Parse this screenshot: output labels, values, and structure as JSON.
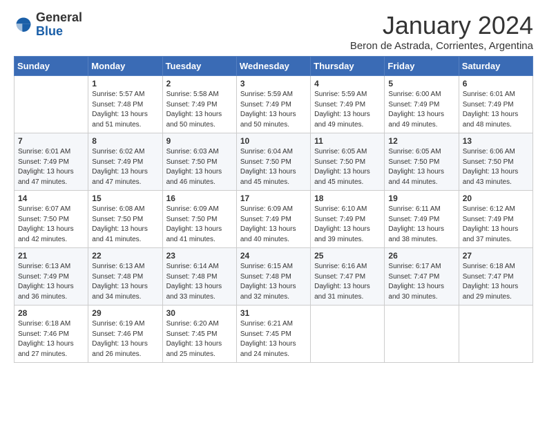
{
  "logo": {
    "general": "General",
    "blue": "Blue"
  },
  "title": "January 2024",
  "subtitle": "Beron de Astrada, Corrientes, Argentina",
  "headers": [
    "Sunday",
    "Monday",
    "Tuesday",
    "Wednesday",
    "Thursday",
    "Friday",
    "Saturday"
  ],
  "weeks": [
    [
      {
        "day": "",
        "info": ""
      },
      {
        "day": "1",
        "info": "Sunrise: 5:57 AM\nSunset: 7:48 PM\nDaylight: 13 hours\nand 51 minutes."
      },
      {
        "day": "2",
        "info": "Sunrise: 5:58 AM\nSunset: 7:49 PM\nDaylight: 13 hours\nand 50 minutes."
      },
      {
        "day": "3",
        "info": "Sunrise: 5:59 AM\nSunset: 7:49 PM\nDaylight: 13 hours\nand 50 minutes."
      },
      {
        "day": "4",
        "info": "Sunrise: 5:59 AM\nSunset: 7:49 PM\nDaylight: 13 hours\nand 49 minutes."
      },
      {
        "day": "5",
        "info": "Sunrise: 6:00 AM\nSunset: 7:49 PM\nDaylight: 13 hours\nand 49 minutes."
      },
      {
        "day": "6",
        "info": "Sunrise: 6:01 AM\nSunset: 7:49 PM\nDaylight: 13 hours\nand 48 minutes."
      }
    ],
    [
      {
        "day": "7",
        "info": ""
      },
      {
        "day": "8",
        "info": "Sunrise: 6:02 AM\nSunset: 7:49 PM\nDaylight: 13 hours\nand 47 minutes."
      },
      {
        "day": "9",
        "info": "Sunrise: 6:03 AM\nSunset: 7:50 PM\nDaylight: 13 hours\nand 46 minutes."
      },
      {
        "day": "10",
        "info": "Sunrise: 6:04 AM\nSunset: 7:50 PM\nDaylight: 13 hours\nand 45 minutes."
      },
      {
        "day": "11",
        "info": "Sunrise: 6:05 AM\nSunset: 7:50 PM\nDaylight: 13 hours\nand 45 minutes."
      },
      {
        "day": "12",
        "info": "Sunrise: 6:05 AM\nSunset: 7:50 PM\nDaylight: 13 hours\nand 44 minutes."
      },
      {
        "day": "13",
        "info": "Sunrise: 6:06 AM\nSunset: 7:50 PM\nDaylight: 13 hours\nand 43 minutes."
      }
    ],
    [
      {
        "day": "14",
        "info": ""
      },
      {
        "day": "15",
        "info": "Sunrise: 6:08 AM\nSunset: 7:50 PM\nDaylight: 13 hours\nand 41 minutes."
      },
      {
        "day": "16",
        "info": "Sunrise: 6:09 AM\nSunset: 7:50 PM\nDaylight: 13 hours\nand 41 minutes."
      },
      {
        "day": "17",
        "info": "Sunrise: 6:09 AM\nSunset: 7:49 PM\nDaylight: 13 hours\nand 40 minutes."
      },
      {
        "day": "18",
        "info": "Sunrise: 6:10 AM\nSunset: 7:49 PM\nDaylight: 13 hours\nand 39 minutes."
      },
      {
        "day": "19",
        "info": "Sunrise: 6:11 AM\nSunset: 7:49 PM\nDaylight: 13 hours\nand 38 minutes."
      },
      {
        "day": "20",
        "info": "Sunrise: 6:12 AM\nSunset: 7:49 PM\nDaylight: 13 hours\nand 37 minutes."
      }
    ],
    [
      {
        "day": "21",
        "info": ""
      },
      {
        "day": "22",
        "info": "Sunrise: 6:13 AM\nSunset: 7:48 PM\nDaylight: 13 hours\nand 34 minutes."
      },
      {
        "day": "23",
        "info": "Sunrise: 6:14 AM\nSunset: 7:48 PM\nDaylight: 13 hours\nand 33 minutes."
      },
      {
        "day": "24",
        "info": "Sunrise: 6:15 AM\nSunset: 7:48 PM\nDaylight: 13 hours\nand 32 minutes."
      },
      {
        "day": "25",
        "info": "Sunrise: 6:16 AM\nSunset: 7:47 PM\nDaylight: 13 hours\nand 31 minutes."
      },
      {
        "day": "26",
        "info": "Sunrise: 6:17 AM\nSunset: 7:47 PM\nDaylight: 13 hours\nand 30 minutes."
      },
      {
        "day": "27",
        "info": "Sunrise: 6:18 AM\nSunset: 7:47 PM\nDaylight: 13 hours\nand 29 minutes."
      }
    ],
    [
      {
        "day": "28",
        "info": "Sunrise: 6:18 AM\nSunset: 7:46 PM\nDaylight: 13 hours\nand 27 minutes."
      },
      {
        "day": "29",
        "info": "Sunrise: 6:19 AM\nSunset: 7:46 PM\nDaylight: 13 hours\nand 26 minutes."
      },
      {
        "day": "30",
        "info": "Sunrise: 6:20 AM\nSunset: 7:45 PM\nDaylight: 13 hours\nand 25 minutes."
      },
      {
        "day": "31",
        "info": "Sunrise: 6:21 AM\nSunset: 7:45 PM\nDaylight: 13 hours\nand 24 minutes."
      },
      {
        "day": "",
        "info": ""
      },
      {
        "day": "",
        "info": ""
      },
      {
        "day": "",
        "info": ""
      }
    ]
  ],
  "week1_sunday_daylight": "Sunrise: 6:01 AM\nSunset: 7:49 PM\nDaylight: 13 hours\nand 47 minutes.",
  "week3_sunday_daylight": "Sunrise: 6:07 AM\nSunset: 7:50 PM\nDaylight: 13 hours\nand 42 minutes.",
  "week4_sunday_daylight": "Sunrise: 6:13 AM\nSunset: 7:49 PM\nDaylight: 13 hours\nand 36 minutes."
}
